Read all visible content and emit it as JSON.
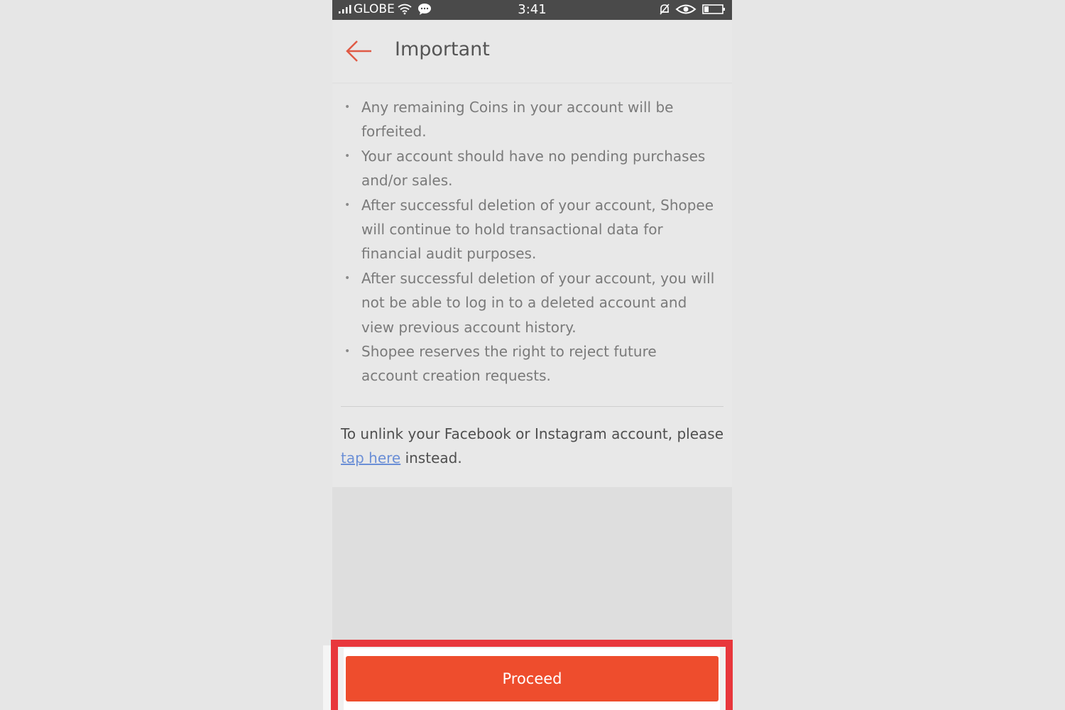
{
  "status_bar": {
    "carrier": "GLOBE",
    "time": "3:41"
  },
  "header": {
    "title": "Important"
  },
  "bullets": [
    {
      "text": "Any remaining Coins in your account will be forfeited."
    },
    {
      "text": "Your account should have no pending purchases and/or sales."
    },
    {
      "text": "After successful deletion of your account, Shopee will continue to hold transactional data for financial audit purposes."
    },
    {
      "text": "After successful deletion of your account, you will not be able to log in to a deleted account and view previous account history."
    },
    {
      "text": "Shopee reserves the right to reject future account creation requests."
    }
  ],
  "bullet_symbol": "•",
  "unlink": {
    "prefix": "To unlink your Facebook or Instagram account, please",
    "link_text": "tap here",
    "suffix": "instead."
  },
  "footer": {
    "proceed_label": "Proceed"
  },
  "colors": {
    "accent": "#ee4d2d",
    "highlight": "#e8373c",
    "link": "#6b8fd6",
    "status_bar": "#4a4a4a"
  }
}
